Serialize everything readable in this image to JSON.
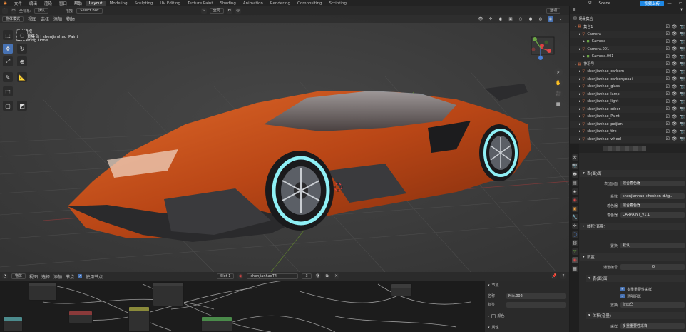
{
  "menubar": {
    "items": [
      "文件",
      "编辑",
      "渲染",
      "窗口",
      "帮助"
    ],
    "workspaces": [
      "Layout",
      "Modeling",
      "Sculpting",
      "UV Editing",
      "Texture Paint",
      "Shading",
      "Animation",
      "Rendering",
      "Compositing",
      "Scripting"
    ],
    "scene": "Scene",
    "notification": "视频上传"
  },
  "viewport": {
    "header": {
      "orientation_label": "坐标系:",
      "orientation_value": "默认",
      "drag_label": "拖拽:",
      "drag_value": "Select Box",
      "transform_pivot": "全局",
      "options": "选项"
    },
    "header2": {
      "mode": "物体模式",
      "menus": [
        "视图",
        "选择",
        "添加",
        "物体"
      ]
    },
    "overlay": {
      "line1": "用户透视",
      "line2": "(1) 场景集合 | shenjianhao_Paint",
      "line3": "Rendering Done"
    }
  },
  "outliner": {
    "root": "场景集合",
    "rows": [
      {
        "label": "集合1",
        "indent": 1
      },
      {
        "label": "Camera",
        "indent": 2
      },
      {
        "label": "Camera",
        "indent": 3
      },
      {
        "label": "Camera.001",
        "indent": 2
      },
      {
        "label": "Camera.001",
        "indent": 3
      },
      {
        "label": "神羽号",
        "indent": 1
      },
      {
        "label": "shenjianhao_carbom",
        "indent": 2
      },
      {
        "label": "shenjianhao_carbonyexail",
        "indent": 2
      },
      {
        "label": "shenjianhao_glass",
        "indent": 2
      },
      {
        "label": "shenjianhao_lamp",
        "indent": 2
      },
      {
        "label": "shenjianhao_light",
        "indent": 2
      },
      {
        "label": "shenjianhao_other",
        "indent": 2
      },
      {
        "label": "shenjianhao_Paint",
        "indent": 2
      },
      {
        "label": "shenjianhao_peijian",
        "indent": 2
      },
      {
        "label": "shenjianhao_tire",
        "indent": 2
      },
      {
        "label": "shenjianhao_wheel",
        "indent": 2
      }
    ]
  },
  "properties": {
    "section_surface": "表(面)面",
    "surface_label": "表(面)面",
    "surface_value": "混合着色器",
    "factor_label": "系数",
    "factor_value": "shenjianhao_cheshen_d.tg..",
    "shader1_label": "着色器",
    "shader1_value": "混合着色器",
    "shader2_label": "着色器",
    "shader2_value": "CARPAINT_v1.1",
    "section_volume": "体积(音量)",
    "displacement_label": "置换",
    "displacement_value": "默认",
    "section_settings": "设置",
    "pass_index_label": "通道编号",
    "pass_index_value": "0",
    "section_surface2": "表(面)面",
    "multi_importance": "多重重要性采样",
    "transparent_shadow": "透明阴影",
    "displacement2_label": "置换",
    "displacement2_value": "仅凹凸",
    "section_volume2": "体积(音量)",
    "sampling_label": "采样",
    "sampling_value": "多重重要性采样"
  },
  "node_editor": {
    "header": {
      "type": "物体",
      "menus": [
        "视图",
        "选择",
        "添加",
        "节点"
      ],
      "use_nodes": "使用节点",
      "slot": "Slot 1",
      "material": "shenjianhaoT4",
      "users": "3"
    },
    "side": {
      "section_node": "节点",
      "name_label": "名称",
      "name_value": "Mix.002",
      "label_label": "标签",
      "color_section": "颜色",
      "props_section": "属性"
    }
  },
  "colors": {
    "accent": "#4772b3",
    "car_orange": "#c4511c",
    "wheel_glow": "#7fe3ee",
    "grid": "#4a4a4a"
  }
}
